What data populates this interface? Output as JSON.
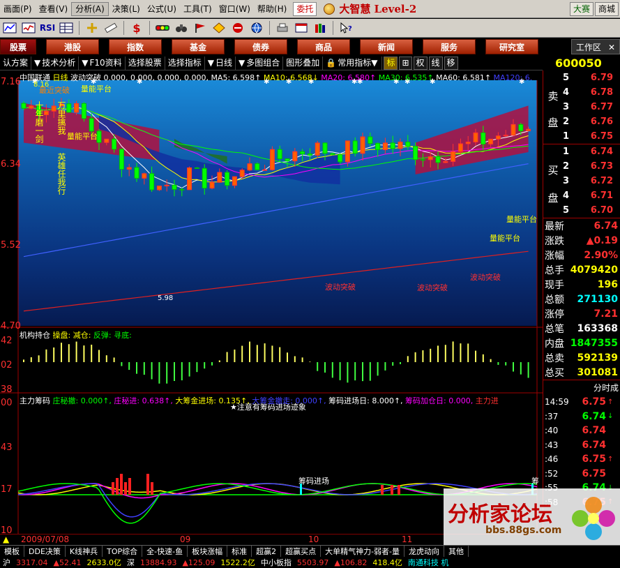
{
  "menu": {
    "items": [
      "画面(P)",
      "查看(V)",
      "分析(A)",
      "决策(L)",
      "公式(U)",
      "工具(T)",
      "窗口(W)",
      "帮助(H)"
    ],
    "badge": "委托",
    "brand": "大智慧 Level-2",
    "right_tabs": [
      "大赛",
      "商城"
    ]
  },
  "toolbar": {
    "icons": [
      "kline-icon",
      "minute-chart-icon",
      "rsi-icon",
      "table-icon",
      "crosshair-icon",
      "ruler-icon",
      "dollar-icon",
      "traffic-light-icon",
      "binoculars-icon",
      "flag-icon",
      "diamond-icon",
      "no-entry-icon",
      "globe-icon",
      "printer-icon",
      "window-icon",
      "books-icon",
      "help-cursor-icon"
    ],
    "rsi_label": "RSI"
  },
  "nav": {
    "tabs": [
      "股票",
      "港股",
      "指数",
      "基金",
      "债券",
      "商品",
      "新闻",
      "服务",
      "研究室"
    ],
    "active": "股票",
    "workarea": "工作区",
    "workarea_close": "✕"
  },
  "subbar": {
    "items": [
      "认方案",
      "技术分析",
      "F10资料",
      "选择股票",
      "选择指标",
      "日线",
      "多图组合",
      "图形叠加",
      "常用指标"
    ],
    "boxes": [
      "标",
      "权",
      "线",
      "移"
    ],
    "arrow": "▼"
  },
  "quote": {
    "code": "600050",
    "name_char": "中",
    "sell_label": [
      "卖",
      "盘"
    ],
    "buy_label": [
      "买",
      "盘"
    ],
    "sells": [
      {
        "lv": "5",
        "price": "6.79"
      },
      {
        "lv": "4",
        "price": "6.78"
      },
      {
        "lv": "3",
        "price": "6.77"
      },
      {
        "lv": "2",
        "price": "6.76"
      },
      {
        "lv": "1",
        "price": "6.75"
      }
    ],
    "buys": [
      {
        "lv": "1",
        "price": "6.74"
      },
      {
        "lv": "2",
        "price": "6.73"
      },
      {
        "lv": "3",
        "price": "6.72"
      },
      {
        "lv": "4",
        "price": "6.71"
      },
      {
        "lv": "5",
        "price": "6.70"
      }
    ],
    "stats": [
      {
        "k": "最新",
        "v": "6.74",
        "c": "#ff3030"
      },
      {
        "k": "涨跌",
        "v": "▲0.19",
        "c": "#ff3030"
      },
      {
        "k": "涨幅",
        "v": "2.90%",
        "c": "#ff3030"
      },
      {
        "k": "总手",
        "v": "4079420",
        "c": "#ffff00"
      },
      {
        "k": "现手",
        "v": "196",
        "c": "#ffff00"
      },
      {
        "k": "总额",
        "v": "271130",
        "c": "#00ffff"
      },
      {
        "k": "涨停",
        "v": "7.21",
        "c": "#ff3030"
      },
      {
        "k": "总笔",
        "v": "163368",
        "c": "#ffffff"
      },
      {
        "k": "内盘",
        "v": "1847355",
        "c": "#00ff00"
      },
      {
        "k": "总卖",
        "v": "592139",
        "c": "#ffff00"
      },
      {
        "k": "总买",
        "v": "301081",
        "c": "#ffff00"
      }
    ],
    "ticks_header": "分时成",
    "ticks": [
      {
        "t": "14:59",
        "p": "6.75",
        "a": "↑"
      },
      {
        "t": ":37",
        "p": "6.74",
        "a": "↓"
      },
      {
        "t": ":40",
        "p": "6.74",
        "a": ""
      },
      {
        "t": ":43",
        "p": "6.74",
        "a": ""
      },
      {
        "t": ":46",
        "p": "6.75",
        "a": "↑"
      },
      {
        "t": ":52",
        "p": "6.75",
        "a": ""
      },
      {
        "t": ":55",
        "p": "6.74",
        "a": "↓"
      },
      {
        "t": ":58",
        "p": "6.75",
        "a": "↑"
      }
    ]
  },
  "chart": {
    "title_parts": [
      {
        "t": "中国联通 ",
        "c": "#ffffff"
      },
      {
        "t": "日线 ",
        "c": "#ffff00"
      },
      {
        "t": "波动突破 ",
        "c": "#ffffff"
      },
      {
        "t": "0.000, 0.000, 0.000, 0.000, ",
        "c": "#ffffff"
      },
      {
        "t": "MA5: 6.598↑ ",
        "c": "#ffffff"
      },
      {
        "t": "MA10: 6.568↓ ",
        "c": "#ffff00"
      },
      {
        "t": "MA20: 6.580↑ ",
        "c": "#ff00ff"
      },
      {
        "t": "MA30: 6.535↑ ",
        "c": "#00ff00"
      },
      {
        "t": "MA60: 6.581↑ ",
        "c": "#ffffff"
      },
      {
        "t": "MA120: 6.",
        "c": "#4040ff"
      }
    ],
    "y_labels_main": [
      "7.16",
      "6.34",
      "5.52",
      "4.70"
    ],
    "high_label": "8.16",
    "low_label": "5.98",
    "annotations": [
      "量能平台",
      "量能平台",
      "波动突破",
      "波动突破",
      "波动突破",
      "量能平台",
      "量能平台"
    ],
    "vert_text": [
      "十年磨一剑",
      "万里擒我",
      "英雄任我行"
    ],
    "misc_label": "最近突破",
    "vol_title_parts": [
      {
        "t": "机构持仓 ",
        "c": "#ffffff"
      },
      {
        "t": "操盘: ",
        "c": "#ffff00"
      },
      {
        "t": "减仓: ",
        "c": "#ffff00"
      },
      {
        "t": "反弹: ",
        "c": "#00ff00"
      },
      {
        "t": "寻底:",
        "c": "#00ff00"
      }
    ],
    "vol_labels": [
      "42",
      "02",
      "38"
    ],
    "ind_title_parts": [
      {
        "t": "主力筹码 ",
        "c": "#ffffff"
      },
      {
        "t": "庄秘撤: 0.000↑, ",
        "c": "#00ff00"
      },
      {
        "t": "庄秘进: 0.638↑, ",
        "c": "#ff00ff"
      },
      {
        "t": "大筹金进场: 0.135↑, ",
        "c": "#ffff00"
      },
      {
        "t": "大筹金撤走: 0.000↑, ",
        "c": "#4040ff"
      },
      {
        "t": "筹码进场日: 8.000↑, ",
        "c": "#ffffff"
      },
      {
        "t": "筹码加仓日: 0.000, ",
        "c": "#ff00ff"
      },
      {
        "t": "主力进",
        "c": "#ff3030"
      }
    ],
    "ind_subtitle": "★注意有筹码进场迹象",
    "ind_labels": [
      "00",
      "43",
      "17",
      "10"
    ],
    "ind_annotation": "筹码进场",
    "ind_annotation2": "筹",
    "timeline": [
      "2009/07/08",
      "09",
      "10",
      "11"
    ]
  },
  "bottom_tabs": [
    "模板",
    "DDE决策",
    "K线神兵",
    "TOP综合",
    "全-快速-鱼",
    "板块涨幅",
    "标准",
    "超赢2",
    "超赢买点",
    "大单精气神力-弱者-量",
    "龙虎动向",
    "其他"
  ],
  "status": [
    {
      "t": "沪",
      "c": "#ffffff"
    },
    {
      "t": "3317.04",
      "c": "#ff3030"
    },
    {
      "t": "▲52.41",
      "c": "#ff3030"
    },
    {
      "t": "2633.0亿",
      "c": "#ffff00"
    },
    {
      "t": "深",
      "c": "#ffffff"
    },
    {
      "t": "13884.93",
      "c": "#ff3030"
    },
    {
      "t": "▲125.09",
      "c": "#ff3030"
    },
    {
      "t": "1522.2亿",
      "c": "#ffff00"
    },
    {
      "t": "中小板指",
      "c": "#ffffff"
    },
    {
      "t": "5503.97",
      "c": "#ff3030"
    },
    {
      "t": "▲106.82",
      "c": "#ff3030"
    },
    {
      "t": "418.4亿",
      "c": "#ffff00"
    },
    {
      "t": "南通科技 机",
      "c": "#00ffff"
    }
  ],
  "watermark": {
    "title": "分析家论坛",
    "url": "bbs.88gs.com"
  }
}
